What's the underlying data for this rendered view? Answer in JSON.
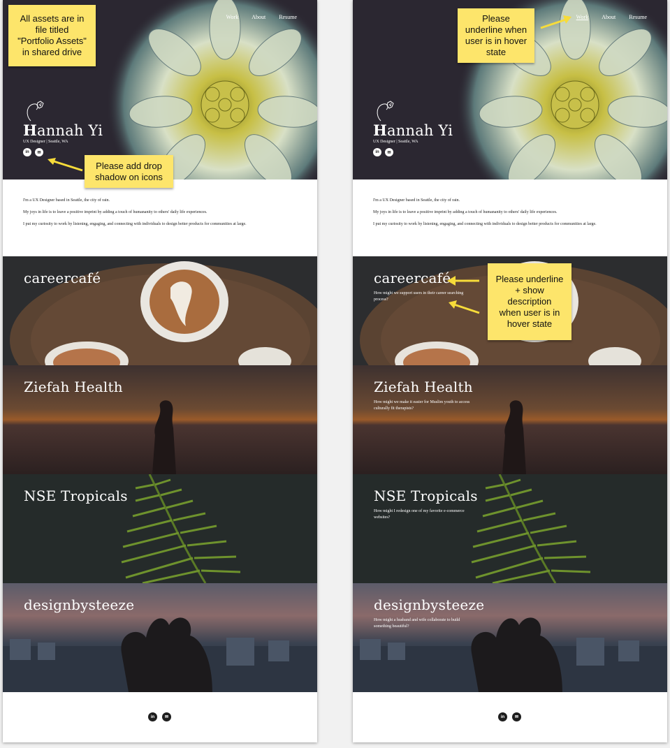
{
  "nav": [
    "Work",
    "About",
    "Resume"
  ],
  "hero": {
    "name_initial": "H",
    "name_rest": "annah Yi",
    "tagline": "UX Designer | Seattle, WA",
    "social_icons": [
      "linkedin-icon",
      "email-icon"
    ],
    "linkedin_glyph": "in",
    "email_glyph": "✉"
  },
  "intro": [
    "I'm a UX Designer based in Seattle, the city of rain.",
    "My joys in life is to leave a positive imprint by adding a touch of humananity to others' daily life experiences.",
    "I put my curiosity to work by listening, engaging, and connecting with individuals to design better products for communities at large."
  ],
  "projects": [
    {
      "title": "careercafé",
      "desc": "How might we support users in their career searching process?"
    },
    {
      "title": "Ziefah Health",
      "desc": "How might we make it easier for Muslim youth to access culturally fit therapists?"
    },
    {
      "title": "NSE Tropicals",
      "desc": "How might I redesign one of my favorite e-commerce websites?"
    },
    {
      "title": "designbysteeze",
      "desc": "How might a husband and wife collaborate to build something beautiful?"
    }
  ],
  "notes": {
    "assets": "All assets are in\nfile titled\n\"Portfolio Assets\"\nin shared drive",
    "drop_shadow": "Please add drop\nshadow on icons",
    "nav_underline": "Please\nunderline when\nuser is in hover\nstate",
    "project_hover": "Please underline\n+ show\ndescription\nwhen user is in\nhover state"
  },
  "colors": {
    "note_bg": "#fde56b",
    "hero_bg": "#2b2731",
    "flower_petal": "#dfe6cf",
    "flower_center": "#c9c246"
  }
}
